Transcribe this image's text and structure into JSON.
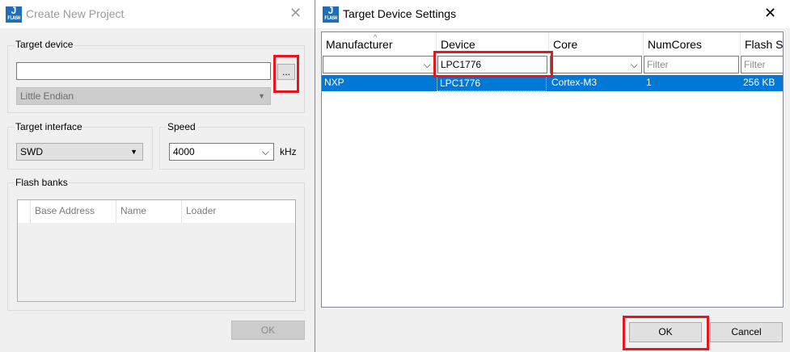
{
  "left_window": {
    "title": "Create New Project",
    "icon_letter": "J",
    "icon_sub": "FLASH",
    "target_device": {
      "label": "Target device",
      "value": "",
      "browse_label": "...",
      "endian": "Little Endian"
    },
    "target_interface": {
      "label": "Target interface",
      "value": "SWD"
    },
    "speed": {
      "label": "Speed",
      "value": "4000",
      "unit": "kHz"
    },
    "flash_banks": {
      "label": "Flash banks",
      "columns": [
        "Base Address",
        "Name",
        "Loader"
      ]
    },
    "ok_label": "OK"
  },
  "right_window": {
    "title": "Target Device Settings",
    "icon_letter": "J",
    "icon_sub": "FLASH",
    "columns": [
      "Manufacturer",
      "Device",
      "Core",
      "NumCores",
      "Flash S"
    ],
    "filters": {
      "manufacturer": "",
      "device": "LPC1776",
      "core": "",
      "numcores_placeholder": "Filter",
      "flash_placeholder": "Filter"
    },
    "rows": [
      {
        "manufacturer": "NXP",
        "device": "LPC1776",
        "core": "Cortex-M3",
        "numcores": "1",
        "flash": "256 KB"
      }
    ],
    "ok_label": "OK",
    "cancel_label": "Cancel"
  },
  "colors": {
    "selection": "#0078d7",
    "highlight": "#e8141e",
    "icon_blue": "#1e6fb7"
  }
}
